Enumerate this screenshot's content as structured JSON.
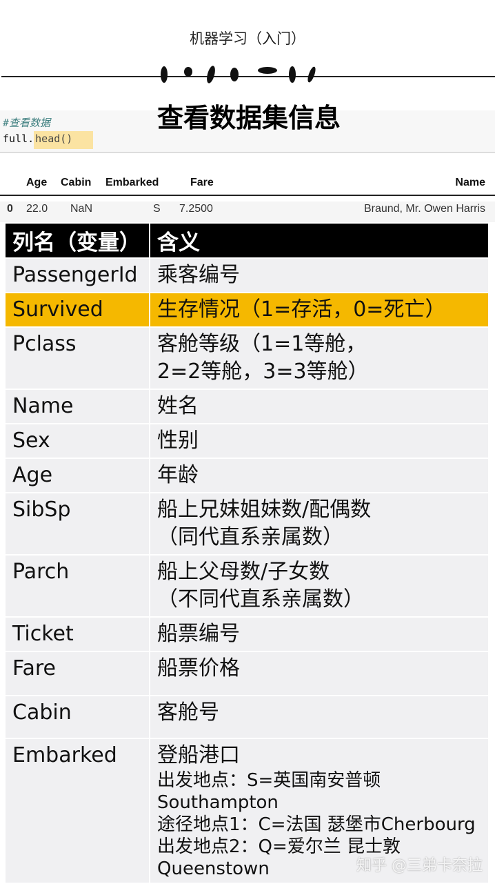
{
  "header": {
    "top_title": "机器学习（入门）",
    "title": "查看数据集信息"
  },
  "code": {
    "comment": "#查看数据",
    "obj": "full.",
    "method": "head()"
  },
  "dataframe": {
    "columns": [
      "Age",
      "Cabin",
      "Embarked",
      "Fare",
      "Name"
    ],
    "row": {
      "index": "0",
      "Age": "22.0",
      "Cabin": "NaN",
      "Embarked": "S",
      "Fare": "7.2500",
      "Name": "Braund, Mr. Owen Harris"
    }
  },
  "table": {
    "headers": [
      "列名（变量）",
      "含义"
    ],
    "highlight_color": "#f5b800",
    "rows": [
      {
        "name": "PassengerId",
        "lines": [
          "乘客编号"
        ]
      },
      {
        "name": "Survived",
        "lines": [
          "生存情况（1=存活，0=死亡）"
        ]
      },
      {
        "name": "Pclass",
        "lines": [
          "客舱等级（1=1等舱，",
          "2=2等舱，3=3等舱）"
        ]
      },
      {
        "name": "Name",
        "lines": [
          "姓名"
        ]
      },
      {
        "name": "Sex",
        "lines": [
          "性别"
        ]
      },
      {
        "name": "Age",
        "lines": [
          "年龄"
        ]
      },
      {
        "name": "SibSp",
        "lines": [
          "船上兄妹姐妹数/配偶数",
          "（同代直系亲属数）"
        ]
      },
      {
        "name": "Parch",
        "lines": [
          "船上父母数/子女数",
          "（不同代直系亲属数）"
        ]
      },
      {
        "name": "Ticket",
        "lines": [
          "船票编号"
        ]
      },
      {
        "name": "Fare",
        "lines": [
          "船票价格"
        ]
      },
      {
        "name": "Cabin",
        "lines": [
          "客舱号"
        ]
      },
      {
        "name": "Embarked",
        "lines": [
          "登船港口"
        ],
        "details": [
          "出发地点：S=英国南安普顿",
          "Southampton",
          "途径地点1：C=法国 瑟堡市Cherbourg",
          "出发地点2：Q=爱尔兰 昆士敦",
          "Queenstown"
        ]
      }
    ]
  },
  "watermark": "知乎 @三弟卡奈拉"
}
